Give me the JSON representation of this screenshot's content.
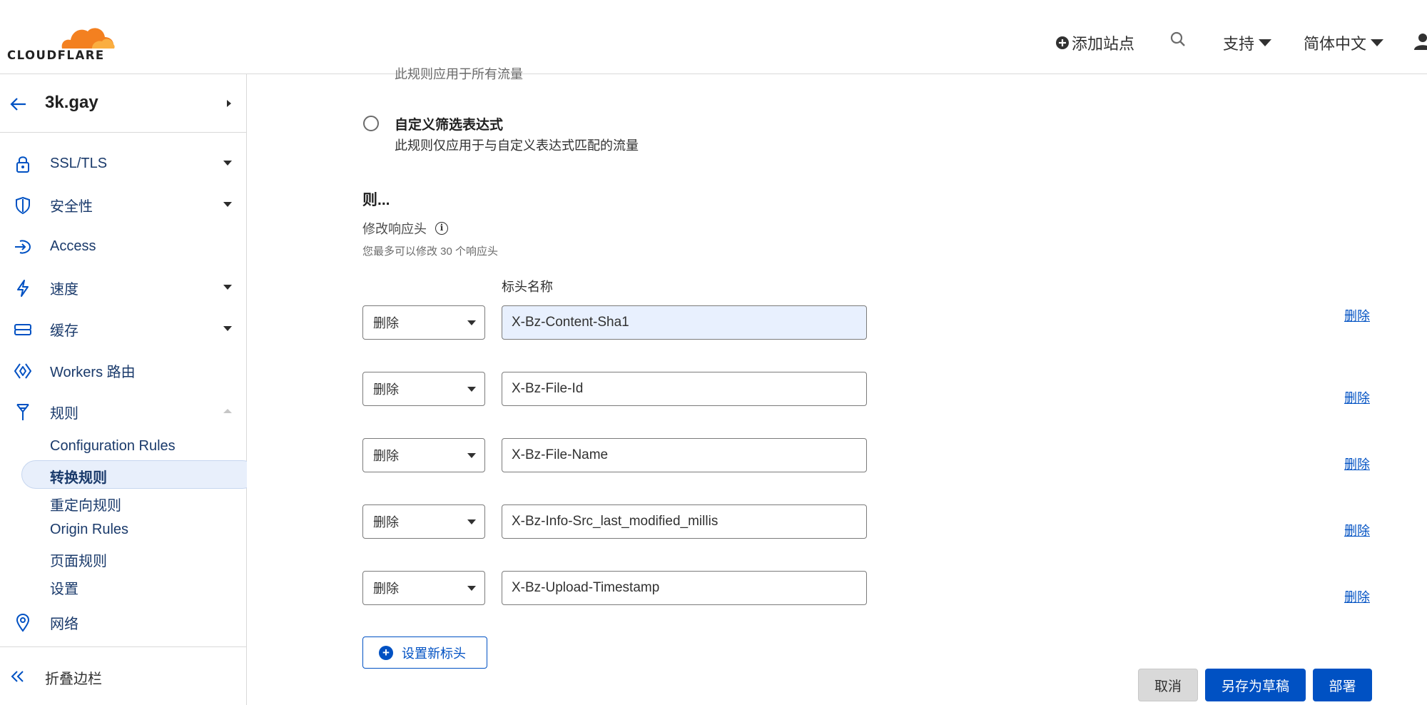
{
  "colors": {
    "accent": "#0051c3",
    "logo_orange": "#f38020",
    "logo_light": "#faae40",
    "nav_text": "#1a3a6b",
    "active_bg": "#e8effb"
  },
  "header": {
    "logo_text": "CLOUDFLARE",
    "add_site": "添加站点",
    "support": "支持",
    "language": "简体中文",
    "icons": [
      "plus-circle-icon",
      "search-icon",
      "user-icon"
    ]
  },
  "sidebar": {
    "zone": "3k.gay",
    "items": [
      {
        "label": "SSL/TLS",
        "icon": "lock-icon"
      },
      {
        "label": "安全性",
        "icon": "shield-icon"
      },
      {
        "label": "Access",
        "icon": "access-icon"
      },
      {
        "label": "速度",
        "icon": "lightning-icon"
      },
      {
        "label": "缓存",
        "icon": "cache-icon"
      },
      {
        "label": "Workers 路由",
        "icon": "workers-icon"
      },
      {
        "label": "规则",
        "icon": "rules-icon"
      },
      {
        "label": "网络",
        "icon": "location-icon"
      }
    ],
    "rules_sub": [
      "Configuration Rules",
      "转换规则",
      "重定向规则",
      "Origin Rules",
      "页面规则",
      "设置"
    ],
    "active_sub": "转换规则",
    "collapse": "折叠边栏"
  },
  "main": {
    "cut_text": "此规则应用于所有流量",
    "custom_filter_title": "自定义筛选表达式",
    "custom_filter_desc": "此规则仅应用于与自定义表达式匹配的流量",
    "then_title": "则...",
    "modify_label": "修改响应头",
    "limit_text": "您最多可以修改 30 个响应头",
    "header_name_col": "标头名称",
    "rows": [
      {
        "op": "删除",
        "name": "X-Bz-Content-Sha1",
        "remove": "删除"
      },
      {
        "op": "删除",
        "name": "X-Bz-File-Id",
        "remove": "删除"
      },
      {
        "op": "删除",
        "name": "X-Bz-File-Name",
        "remove": "删除"
      },
      {
        "op": "删除",
        "name": "X-Bz-Info-Src_last_modified_millis",
        "remove": "删除"
      },
      {
        "op": "删除",
        "name": "X-Bz-Upload-Timestamp",
        "remove": "删除"
      }
    ],
    "add_header": "设置新标头",
    "cancel": "取消",
    "save_draft": "另存为草稿",
    "deploy": "部署"
  }
}
